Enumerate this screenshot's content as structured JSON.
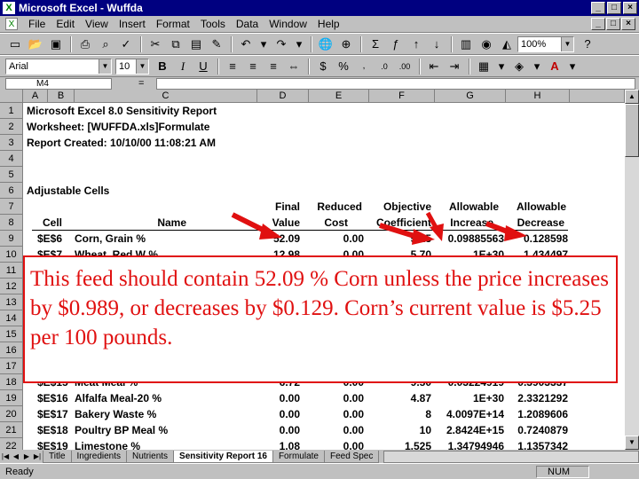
{
  "window": {
    "title": "Microsoft Excel - Wuffda",
    "app_icon": "excel-icon",
    "buttons": [
      "_",
      "□",
      "×"
    ]
  },
  "menu": {
    "items": [
      "File",
      "Edit",
      "View",
      "Insert",
      "Format",
      "Tools",
      "Data",
      "Window",
      "Help"
    ],
    "doc_buttons": [
      "_",
      "□",
      "×"
    ]
  },
  "toolbar": {
    "zoom": "100%",
    "font": "Arial",
    "size": "10"
  },
  "formula_bar": {
    "name_box": "M4",
    "equals": "="
  },
  "columns": [
    "A",
    "B",
    "C",
    "D",
    "E",
    "F",
    "G",
    "H"
  ],
  "rows": [
    "1",
    "2",
    "3",
    "4",
    "5",
    "6",
    "7",
    "8",
    "9",
    "10",
    "11",
    "12",
    "13",
    "14",
    "15",
    "16",
    "17",
    "18",
    "19",
    "20",
    "21",
    "22"
  ],
  "report": {
    "line1": "Microsoft Excel 8.0 Sensitivity Report",
    "line2": "Worksheet: [WUFFDA.xls]Formulate",
    "line3": "Report Created: 10/10/00 11:08:21 AM",
    "section": "Adjustable Cells"
  },
  "headers": {
    "top": [
      "",
      "",
      "Final",
      "Reduced",
      "Objective",
      "Allowable",
      "Allowable"
    ],
    "bottom": [
      "Cell",
      "Name",
      "Value",
      "Cost",
      "Coefficient",
      "Increase",
      "Decrease"
    ]
  },
  "table": [
    {
      "cell": "$E$6",
      "name": "Corn, Grain %",
      "value": "52.09",
      "cost": "0.00",
      "coef": "5.25",
      "inc": "0.09885563",
      "dec": "0.128598"
    },
    {
      "cell": "$E$7",
      "name": "Wheat, Red W %",
      "value": "12.98",
      "cost": "0.00",
      "coef": "5.70",
      "inc": "1E+30",
      "dec": "1.434497"
    },
    {
      "cell": "$E$15",
      "name": "Meat Meal %",
      "value": "6.72",
      "cost": "0.00",
      "coef": "9.50",
      "inc": "0.03224919",
      "dec": "0.3903337"
    },
    {
      "cell": "$E$16",
      "name": "Alfalfa Meal-20 %",
      "value": "0.00",
      "cost": "0.00",
      "coef": "4.87",
      "inc": "1E+30",
      "dec": "2.3321292"
    },
    {
      "cell": "$E$17",
      "name": "Bakery Waste %",
      "value": "0.00",
      "cost": "0.00",
      "coef": "8",
      "inc": "4.0097E+14",
      "dec": "1.2089606"
    },
    {
      "cell": "$E$18",
      "name": "Poultry BP Meal %",
      "value": "0.00",
      "cost": "0.00",
      "coef": "10",
      "inc": "2.8424E+15",
      "dec": "0.7240879"
    },
    {
      "cell": "$E$19",
      "name": "Limestone %",
      "value": "1.08",
      "cost": "0.00",
      "coef": "1.525",
      "inc": "1.34794946",
      "dec": "1.1357342"
    }
  ],
  "callout": {
    "text": "This feed should contain 52.09 % Corn unless the price increases by $0.989, or decreases by $0.129. Corn’s current value is $5.25 per 100 pounds."
  },
  "tabs": [
    "Title",
    "Ingredients",
    "Nutrients",
    "Sensitivity Report 16",
    "Formulate",
    "Feed Spec"
  ],
  "active_tab": "Sensitivity Report 16",
  "status": {
    "ready": "Ready",
    "num": "NUM"
  },
  "colors": {
    "titlebar": "#000080",
    "callout_border": "#e01010",
    "callout_text": "#e01010",
    "arrow": "#e01010"
  }
}
